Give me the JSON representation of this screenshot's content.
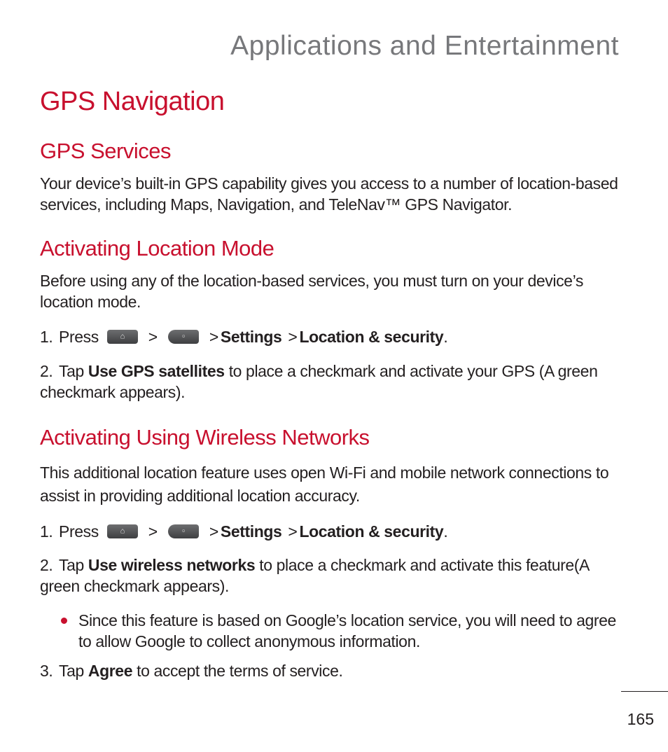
{
  "chapter_title": "Applications and Entertainment",
  "section_title": "GPS Navigation",
  "gps_services": {
    "heading": "GPS Services",
    "body": "Your device’s built-in GPS capability gives you access to a number of location-based services, including Maps, Navigation, and TeleNav™ GPS Navigator."
  },
  "location_mode": {
    "heading": "Activating Location Mode",
    "body": "Before using any of the location-based services, you must turn on your device’s location mode.",
    "steps": [
      {
        "num": "1.",
        "prefix": "Press",
        "home_key_icon": "home-key-icon",
        "menu_key_icon": "menu-key-icon",
        "sep": ">",
        "settings": "Settings",
        "location_security": "Location & security",
        "end": "."
      },
      {
        "num": "2.",
        "prefix": "Tap",
        "bold": "Use GPS satellites",
        "rest": "to place a checkmark and activate your GPS (A green checkmark appears)."
      }
    ]
  },
  "wireless": {
    "heading": "Activating Using Wireless Networks",
    "body": "This additional location feature uses open Wi-Fi and mobile network connections to assist in providing additional location accuracy.",
    "steps": [
      {
        "num": "1.",
        "prefix": "Press",
        "sep": ">",
        "settings": "Settings",
        "location_security": "Location & security",
        "end": "."
      },
      {
        "num": "2.",
        "prefix": "Tap",
        "bold": "Use wireless networks",
        "rest": "to place a checkmark and activate this feature(A green checkmark appears)."
      },
      {
        "num": "3.",
        "prefix": "Tap",
        "bold": "Agree",
        "rest": "to accept the terms of service."
      }
    ],
    "bullet": "Since this feature is based on Google’s location service, you will need to agree to allow Google to collect anonymous information."
  },
  "page_number": "165",
  "colors": {
    "accent": "#c8102e",
    "chapter_gray": "#77787b",
    "text": "#231f20"
  }
}
